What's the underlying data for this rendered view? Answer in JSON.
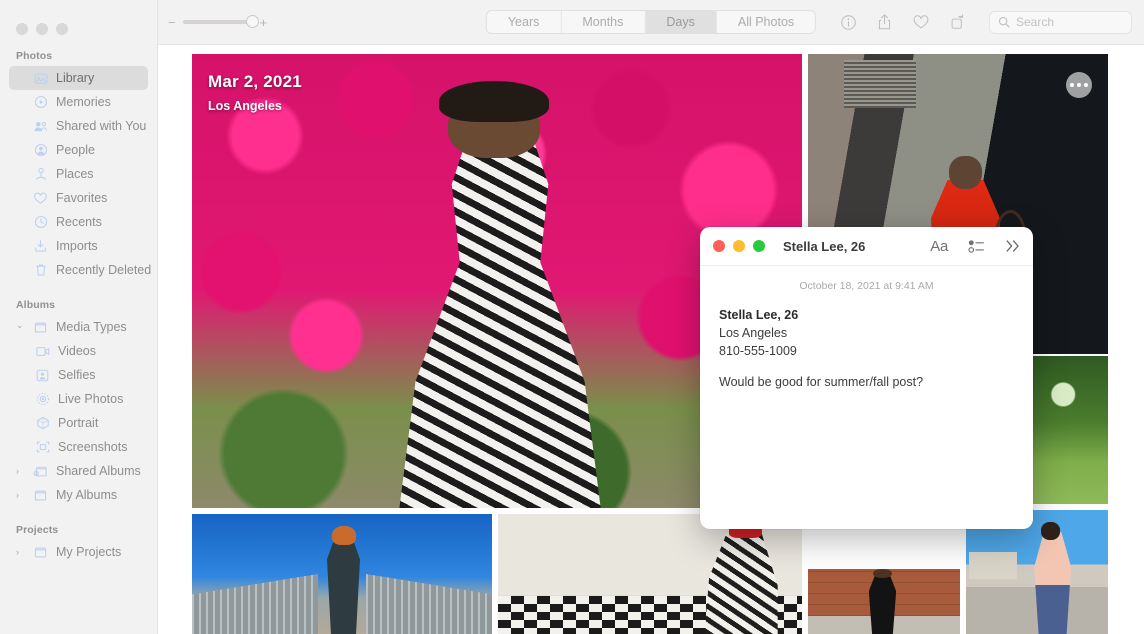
{
  "app": {
    "name": "Photos",
    "window_controls": [
      "close",
      "minimize",
      "zoom"
    ]
  },
  "toolbar": {
    "zoom_minus": "−",
    "zoom_plus": "+",
    "zoom_level": 85,
    "segments": [
      {
        "label": "Years",
        "active": false
      },
      {
        "label": "Months",
        "active": false
      },
      {
        "label": "Days",
        "active": true
      },
      {
        "label": "All Photos",
        "active": false
      }
    ],
    "icons": [
      {
        "name": "info-icon",
        "title": "Info"
      },
      {
        "name": "share-icon",
        "title": "Share"
      },
      {
        "name": "heart-icon",
        "title": "Favorite"
      },
      {
        "name": "rotate-icon",
        "title": "Rotate"
      }
    ],
    "search": {
      "placeholder": "Search",
      "value": ""
    }
  },
  "sidebar": {
    "sections": [
      {
        "title": "Photos",
        "items": [
          {
            "label": "Library",
            "icon": "library-icon",
            "selected": true,
            "indent": 0,
            "twisty": ""
          },
          {
            "label": "Memories",
            "icon": "memories-icon",
            "selected": false,
            "indent": 0,
            "twisty": ""
          },
          {
            "label": "Shared with You",
            "icon": "shared-with-you-icon",
            "selected": false,
            "indent": 0,
            "twisty": ""
          },
          {
            "label": "People",
            "icon": "people-icon",
            "selected": false,
            "indent": 0,
            "twisty": ""
          },
          {
            "label": "Places",
            "icon": "places-icon",
            "selected": false,
            "indent": 0,
            "twisty": ""
          },
          {
            "label": "Favorites",
            "icon": "heart-icon",
            "selected": false,
            "indent": 0,
            "twisty": ""
          },
          {
            "label": "Recents",
            "icon": "clock-icon",
            "selected": false,
            "indent": 0,
            "twisty": ""
          },
          {
            "label": "Imports",
            "icon": "import-icon",
            "selected": false,
            "indent": 0,
            "twisty": ""
          },
          {
            "label": "Recently Deleted",
            "icon": "trash-icon",
            "selected": false,
            "indent": 0,
            "twisty": ""
          }
        ]
      },
      {
        "title": "Albums",
        "items": [
          {
            "label": "Media Types",
            "icon": "folder-icon",
            "selected": false,
            "indent": 0,
            "twisty": "expanded"
          },
          {
            "label": "Videos",
            "icon": "video-icon",
            "selected": false,
            "indent": 1,
            "twisty": ""
          },
          {
            "label": "Selfies",
            "icon": "selfie-icon",
            "selected": false,
            "indent": 1,
            "twisty": ""
          },
          {
            "label": "Live Photos",
            "icon": "live-photo-icon",
            "selected": false,
            "indent": 1,
            "twisty": ""
          },
          {
            "label": "Portrait",
            "icon": "portrait-icon",
            "selected": false,
            "indent": 1,
            "twisty": ""
          },
          {
            "label": "Screenshots",
            "icon": "screenshot-icon",
            "selected": false,
            "indent": 1,
            "twisty": ""
          },
          {
            "label": "Shared Albums",
            "icon": "shared-album-icon",
            "selected": false,
            "indent": 0,
            "twisty": "collapsed"
          },
          {
            "label": "My Albums",
            "icon": "folder-icon",
            "selected": false,
            "indent": 0,
            "twisty": "collapsed"
          }
        ]
      },
      {
        "title": "Projects",
        "items": [
          {
            "label": "My Projects",
            "icon": "folder-icon",
            "selected": false,
            "indent": 0,
            "twisty": "collapsed"
          }
        ]
      }
    ]
  },
  "grid": {
    "hero": {
      "date": "Mar 2, 2021",
      "place": "Los Angeles",
      "description": "Woman in black-and-white patterned dress standing in front of magenta bougainvillea"
    },
    "more_button": {
      "name": "more-options-button",
      "glyph": "•••"
    },
    "photos": [
      {
        "id": "p1",
        "description": "Woman in patterned dress by magenta bougainvillea"
      },
      {
        "id": "p2",
        "description": "Man in red jacket in doorway with number 8"
      },
      {
        "id": "p3",
        "description": "Person in yellow top and purple pants by green foliage"
      },
      {
        "id": "p4",
        "description": "Woman with red hair in puffer coat on footbridge"
      },
      {
        "id": "p5",
        "description": "Woman in red bucket hat sitting on checkerboard floor"
      },
      {
        "id": "p6",
        "description": "Woman in black dress against orange brick wall"
      },
      {
        "id": "p7",
        "description": "Woman in pink kimono on a sunny street"
      }
    ]
  },
  "notes_window": {
    "title": "Stella Lee, 26",
    "window_controls": [
      "close",
      "minimize",
      "zoom"
    ],
    "tools": [
      {
        "name": "format-text-icon",
        "label": "Aa"
      },
      {
        "name": "checklist-icon",
        "label": ""
      },
      {
        "name": "expand-chevrons-icon",
        "label": "»"
      }
    ],
    "timestamp": "October 18, 2021 at 9:41 AM",
    "content_lines": [
      {
        "text": "Stella Lee, 26",
        "bold": true
      },
      {
        "text": "Los Angeles",
        "bold": false
      },
      {
        "text": "810-555-1009",
        "bold": false
      },
      {
        "text": "",
        "bold": false
      },
      {
        "text": "Would be good for summer/fall post?",
        "bold": false
      }
    ]
  },
  "colors": {
    "sidebar_bg": "#f2f2f2",
    "toolbar_bg": "#f2f2f2",
    "selected_row": "#dcdcdc",
    "sidebar_icon": "#bcd0ef",
    "traffic_red": "#ff5f57",
    "traffic_yellow": "#febc2e",
    "traffic_green": "#28c840",
    "content_bg": "#ffffff"
  }
}
